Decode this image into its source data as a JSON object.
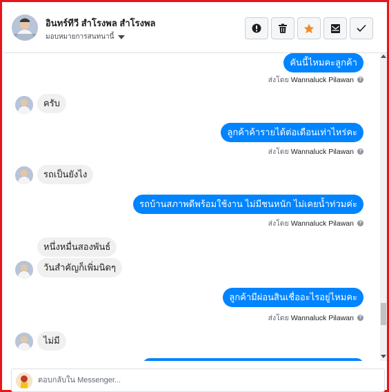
{
  "header": {
    "contact_name": "อินทร์ทีวี สำโรงพล สำโรงพล",
    "assign_label": "มอบหมายการสนทนานี้",
    "buttons": [
      {
        "name": "report-button",
        "icon": "exclamation-icon"
      },
      {
        "name": "delete-button",
        "icon": "trash-icon"
      },
      {
        "name": "star-button",
        "icon": "star-icon"
      },
      {
        "name": "mark-unread-button",
        "icon": "envelope-icon"
      },
      {
        "name": "mark-done-button",
        "icon": "check-icon"
      }
    ]
  },
  "colors": {
    "outgoing_bubble": "#0084ff",
    "incoming_bubble": "#f1f0f0",
    "star": "#f28c28",
    "frame_border": "#e8141c"
  },
  "messages": [
    {
      "direction": "out",
      "text": "คันนี้ไหมคะลูกค้า",
      "sent_by_prefix": "ส่งโดย",
      "sent_by_name": "Wannaluck Pilawan"
    },
    {
      "direction": "in",
      "text": "ครับ"
    },
    {
      "direction": "out",
      "text": "ลูกค้าค้ารายได้ต่อเดือนเท่าไหร่คะ",
      "sent_by_prefix": "ส่งโดย",
      "sent_by_name": "Wannaluck Pilawan"
    },
    {
      "direction": "in",
      "text": "รถเป็นยังไง"
    },
    {
      "direction": "out",
      "text": "รถบ้านสภาพดีพร้อมใช้งาน ไม่มีชนหนัก ไม่เคยน้ำท่วมค่ะ",
      "sent_by_prefix": "ส่งโดย",
      "sent_by_name": "Wannaluck Pilawan"
    },
    {
      "direction": "in",
      "text": "หนึ่งหมื่นสองพันธ์"
    },
    {
      "direction": "in",
      "text": "วันสำคัญก็เพิ่มนิดๆ"
    },
    {
      "direction": "out",
      "text": "ลูกค้ามีผ่อนสินเชื่ออะไรอยู่ไหมคะ",
      "sent_by_prefix": "ส่งโดย",
      "sent_by_name": "Wannaluck Pilawan"
    },
    {
      "direction": "in",
      "text": "ไม่มี"
    }
  ],
  "composer": {
    "placeholder": "ตอบกลับใน Messenger..."
  }
}
